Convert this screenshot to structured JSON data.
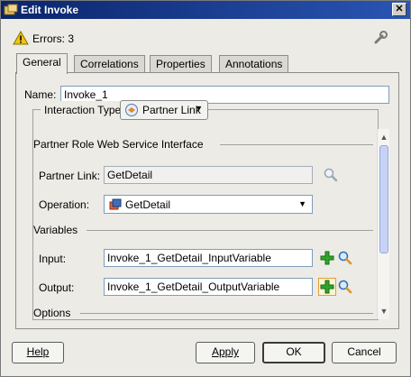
{
  "window": {
    "title": "Edit Invoke",
    "close_glyph": "✕"
  },
  "status": {
    "errors_label": "Errors: 3"
  },
  "tabs": [
    {
      "label": "General",
      "active": true
    },
    {
      "label": "Correlations",
      "active": false
    },
    {
      "label": "Properties",
      "active": false
    },
    {
      "label": "Annotations",
      "active": false
    }
  ],
  "general": {
    "name_label": "Name:",
    "name_value": "Invoke_1",
    "interaction_type_label": "Interaction Type:",
    "interaction_type_value": "Partner Link",
    "partner_role_heading": "Partner Role Web Service Interface",
    "partner_link_label": "Partner Link:",
    "partner_link_value": "GetDetail",
    "operation_label": "Operation:",
    "operation_value": "GetDetail",
    "variables_heading": "Variables",
    "input_label": "Input:",
    "input_value": "Invoke_1_GetDetail_InputVariable",
    "output_label": "Output:",
    "output_value": "Invoke_1_GetDetail_OutputVariable",
    "options_heading": "Options"
  },
  "buttons": {
    "help": "Help",
    "apply": "Apply",
    "ok": "OK",
    "cancel": "Cancel"
  },
  "colors": {
    "titlebar": "#0a246a",
    "add_icon": "#2fa52a",
    "warning": "#f2c40f"
  },
  "icons": [
    "warning-icon",
    "wrench-icon",
    "partner-link-icon",
    "search-icon",
    "add-icon",
    "operation-icon"
  ]
}
